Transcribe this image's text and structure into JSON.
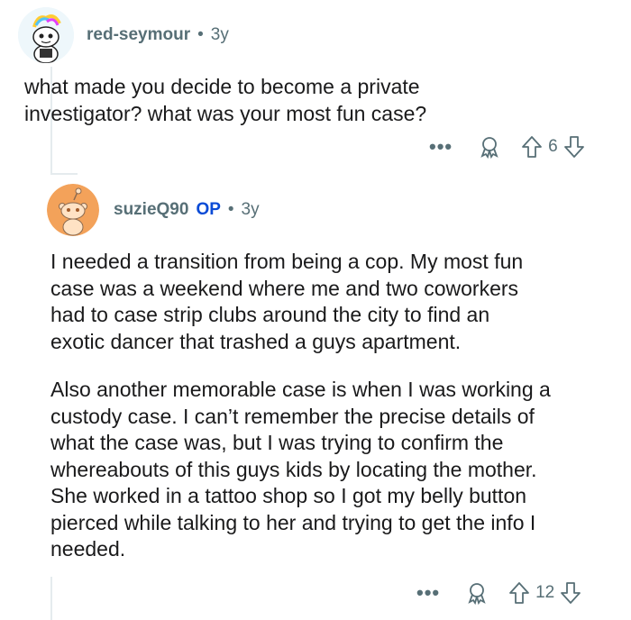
{
  "comment1": {
    "username": "red-seymour",
    "separator": "•",
    "time": "3y",
    "text_line1": "what made you decide to become a private",
    "text_line2": "investigator? what was your most fun case?",
    "more": "•••",
    "votes": "6"
  },
  "comment2": {
    "username": "suzieQ90",
    "op_badge": "OP",
    "separator": "•",
    "time": "3y",
    "paragraph1": [
      "I needed a transition from being a cop. My most fun",
      "case was a weekend where me and two coworkers",
      "had to case strip clubs around the city to find an",
      "exotic dancer that trashed a guys apartment."
    ],
    "paragraph2": [
      "Also another memorable case is when I was working a",
      "custody case. I can’t remember the precise details of",
      "what the case was, but I was trying to confirm the",
      "whereabouts of this guys kids by locating the mother.",
      "She worked in a tattoo shop so I got my belly button",
      "pierced while talking to her and trying to get the info I",
      "needed."
    ],
    "more": "•••",
    "votes": "12"
  },
  "icons": {
    "avatar1": "snoo-avatar-icon",
    "avatar2": "snoo-avatar-icon",
    "award": "award-icon",
    "upvote": "upvote-arrow-icon",
    "downvote": "downvote-arrow-icon"
  },
  "colors": {
    "meta": "#576f76",
    "op": "#0a4bd6",
    "text": "#1a1a1b",
    "avatar2_bg": "#f3a25a"
  }
}
